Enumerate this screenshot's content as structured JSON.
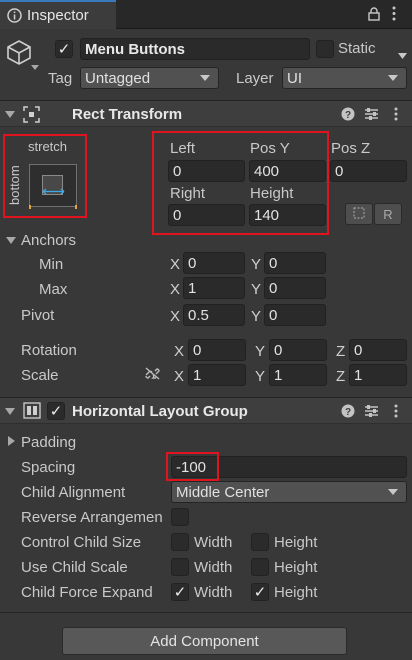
{
  "tab": {
    "title": "Inspector"
  },
  "gameobject": {
    "active": true,
    "name": "Menu Buttons",
    "static_label": "Static",
    "tag_label": "Tag",
    "tag_value": "Untagged",
    "layer_label": "Layer",
    "layer_value": "UI"
  },
  "rect_transform": {
    "title": "Rect Transform",
    "anchor_preset": {
      "top": "stretch",
      "side": "bottom"
    },
    "headers": {
      "left": "Left",
      "pos_y": "Pos Y",
      "pos_z": "Pos Z",
      "right": "Right",
      "height": "Height"
    },
    "values": {
      "left": "0",
      "pos_y": "400",
      "pos_z": "0",
      "right": "0",
      "height": "140"
    },
    "buttons": {
      "raw": "R"
    },
    "anchors": {
      "label": "Anchors",
      "min_label": "Min",
      "min_x": "0",
      "min_y": "0",
      "max_label": "Max",
      "max_x": "1",
      "max_y": "0"
    },
    "pivot": {
      "label": "Pivot",
      "x": "0.5",
      "y": "0"
    },
    "rotation": {
      "label": "Rotation",
      "x": "0",
      "y": "0",
      "z": "0"
    },
    "scale": {
      "label": "Scale",
      "x": "1",
      "y": "1",
      "z": "1"
    },
    "axes": {
      "x": "X",
      "y": "Y",
      "z": "Z"
    }
  },
  "layout_group": {
    "title": "Horizontal Layout Group",
    "enabled": true,
    "padding_label": "Padding",
    "spacing_label": "Spacing",
    "spacing_value": "-100",
    "child_alignment_label": "Child Alignment",
    "child_alignment_value": "Middle Center",
    "reverse_label": "Reverse Arrangemen",
    "control_size_label": "Control Child Size",
    "use_scale_label": "Use Child Scale",
    "force_expand_label": "Child Force Expand",
    "width_label": "Width",
    "height_label": "Height",
    "force_expand_width": true,
    "force_expand_height": true
  },
  "add_component": {
    "label": "Add Component"
  },
  "icons": [
    "inspector-icon",
    "lock-icon",
    "menu-icon",
    "cube-icon",
    "rect-transform-icon",
    "help-icon",
    "settings-icon",
    "more-icon",
    "layout-group-icon",
    "blueprint-icon",
    "unlink-icon"
  ]
}
